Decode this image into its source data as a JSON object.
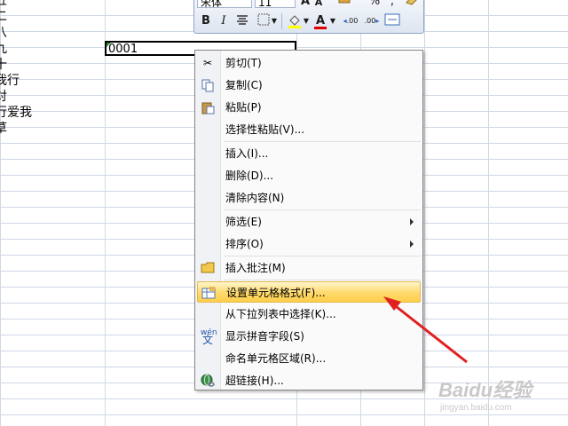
{
  "sheet": {
    "left_column_text": [
      "五",
      "二",
      "八",
      "九",
      "十",
      "我行",
      "对",
      "行爱我",
      "草"
    ],
    "active_cell_value": "0001"
  },
  "mini_toolbar": {
    "font_name": "宋体",
    "font_size": "11",
    "bold": "B",
    "italic": "I",
    "font_color": "A",
    "grow_font": "A",
    "shrink_font": "A",
    "percent": "%",
    "comma": ",",
    "inc_decimal": ".00",
    "dec_decimal": ".00"
  },
  "context_menu": {
    "items": [
      {
        "label": "剪切(T)",
        "icon": "scissors-icon"
      },
      {
        "label": "复制(C)",
        "icon": "copy-icon"
      },
      {
        "label": "粘贴(P)",
        "icon": "paste-icon"
      },
      {
        "label": "选择性粘贴(V)...",
        "icon": ""
      },
      {
        "label": "插入(I)...",
        "icon": ""
      },
      {
        "label": "删除(D)...",
        "icon": ""
      },
      {
        "label": "清除内容(N)",
        "icon": ""
      },
      {
        "label": "筛选(E)",
        "icon": "",
        "submenu": true
      },
      {
        "label": "排序(O)",
        "icon": "",
        "submenu": true
      },
      {
        "label": "插入批注(M)",
        "icon": "comment-icon"
      },
      {
        "label": "设置单元格格式(F)...",
        "icon": "format-cells-icon",
        "highlighted": true
      },
      {
        "label": "从下拉列表中选择(K)...",
        "icon": ""
      },
      {
        "label": "显示拼音字段(S)",
        "icon": "phonetic-icon"
      },
      {
        "label": "命名单元格区域(R)...",
        "icon": ""
      },
      {
        "label": "超链接(H)...",
        "icon": "hyperlink-icon"
      }
    ]
  },
  "annotation": {
    "arrow_color": "#e02020"
  },
  "watermark": {
    "brand": "Baidu经验",
    "url": "jingyan.baidu.com"
  },
  "colors": {
    "highlight": "#ffd96b",
    "grid": "#d0d7e5",
    "menu_border": "#868686"
  }
}
